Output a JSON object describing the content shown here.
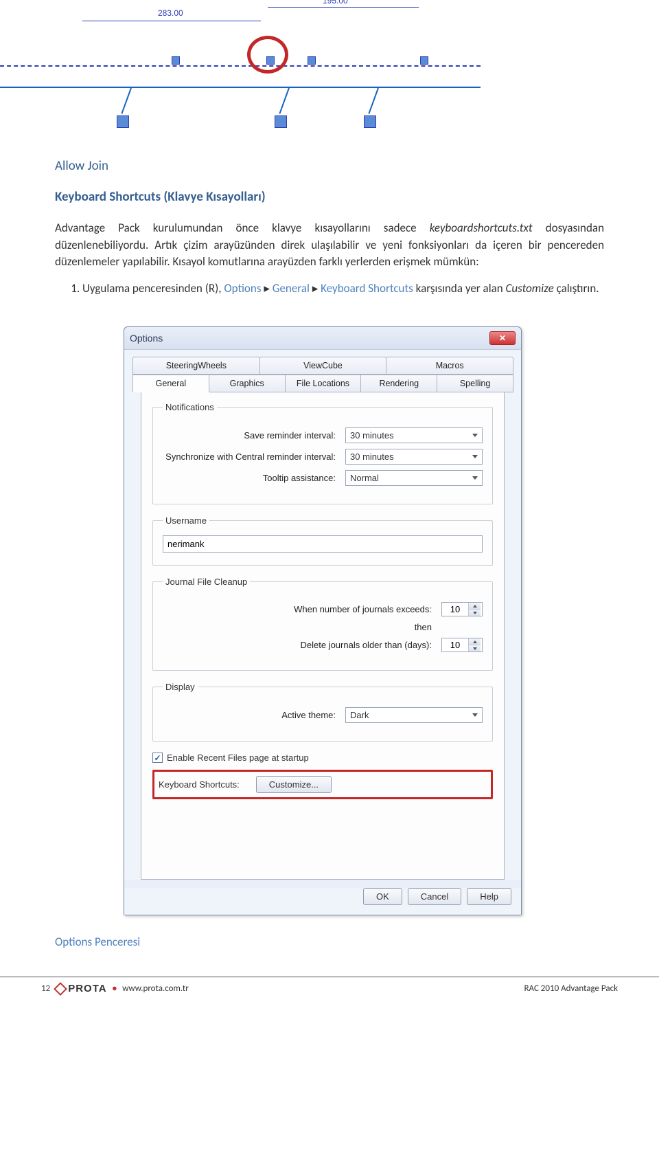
{
  "drawing": {
    "dim1": "283.00",
    "dim2": "195.00"
  },
  "headings": {
    "allow_join": "Allow Join",
    "kb_shortcuts": "Keyboard Shortcuts (Klavye Kısayolları)"
  },
  "paragraphs": {
    "p1_a": "Advantage Pack kurulumundan önce klavye kısayollarını sadece ",
    "p1_b": "keyboardshortcuts.txt",
    "p1_c": " dosyasından düzenlenebiliyordu. Artık çizim arayüzünden direk ulaşılabilir ve yeni fonksiyonları da içeren bir pencereden düzenlemeler yapılabilir. Kısayol komutlarına arayüzden farklı yerlerden erişmek mümkün:"
  },
  "step1": {
    "a": "Uygulama penceresinden (R), ",
    "opt": "Options",
    "arrow": " ▸ ",
    "gen": "General",
    "kb": "Keyboard Shortcuts",
    "b": " karşısında yer alan ",
    "cust": "Customize",
    "c": " çalıştırın."
  },
  "dialog": {
    "title": "Options",
    "tabs_top": [
      "SteeringWheels",
      "ViewCube",
      "Macros"
    ],
    "tabs_bottom": [
      "General",
      "Graphics",
      "File Locations",
      "Rendering",
      "Spelling"
    ],
    "notifications": {
      "legend": "Notifications",
      "save_label": "Save reminder interval:",
      "save_value": "30 minutes",
      "sync_label": "Synchronize with Central reminder interval:",
      "sync_value": "30 minutes",
      "tooltip_label": "Tooltip assistance:",
      "tooltip_value": "Normal"
    },
    "username": {
      "legend": "Username",
      "value": "nerimank"
    },
    "journal": {
      "legend": "Journal File Cleanup",
      "exceeds_label": "When number of journals exceeds:",
      "exceeds_value": "10",
      "then": "then",
      "older_label": "Delete journals older than (days):",
      "older_value": "10"
    },
    "display": {
      "legend": "Display",
      "theme_label": "Active theme:",
      "theme_value": "Dark"
    },
    "enable_recent": "Enable Recent Files page at startup",
    "kb_label": "Keyboard Shortcuts:",
    "customize_btn": "Customize...",
    "ok": "OK",
    "cancel": "Cancel",
    "help": "Help"
  },
  "caption": "Options Penceresi",
  "footer": {
    "page": "12",
    "brand": "PROTA",
    "url": "www.prota.com.tr",
    "product": "RAC 2010 Advantage Pack"
  }
}
